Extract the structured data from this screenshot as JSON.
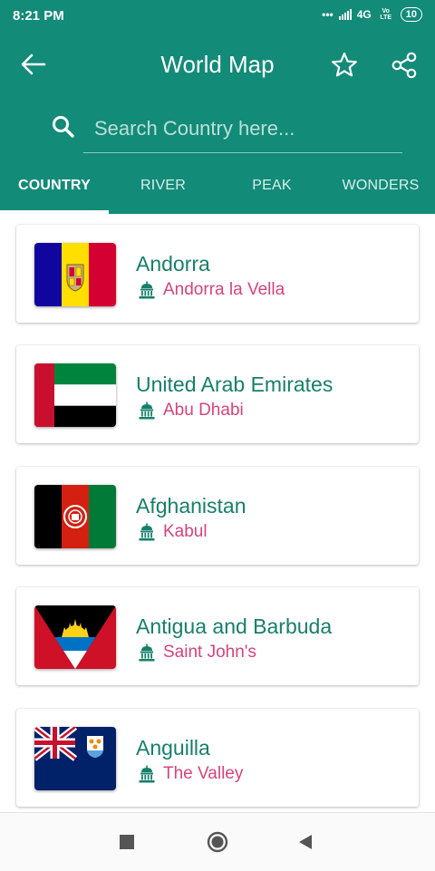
{
  "status_bar": {
    "time": "8:21 PM",
    "dots": "•••",
    "network": "4G",
    "volte": "Vo LTE",
    "battery": "10"
  },
  "toolbar": {
    "title": "World Map"
  },
  "search": {
    "placeholder": "Search Country here..."
  },
  "tabs": [
    {
      "label": "COUNTRY",
      "active": true
    },
    {
      "label": "RIVER",
      "active": false
    },
    {
      "label": "PEAK",
      "active": false
    },
    {
      "label": "WONDERS",
      "active": false
    }
  ],
  "countries": [
    {
      "name": "Andorra",
      "capital": "Andorra la Vella",
      "flag": "andorra-flag"
    },
    {
      "name": "United Arab Emirates",
      "capital": "Abu Dhabi",
      "flag": "uae-flag"
    },
    {
      "name": "Afghanistan",
      "capital": "Kabul",
      "flag": "afghanistan-flag"
    },
    {
      "name": "Antigua and Barbuda",
      "capital": "Saint John's",
      "flag": "antigua-flag"
    },
    {
      "name": "Anguilla",
      "capital": "The Valley",
      "flag": "anguilla-flag"
    }
  ],
  "colors": {
    "primary": "#128b78",
    "country_name": "#167f6b",
    "capital": "#d6437b"
  },
  "icons": {
    "back": "back-arrow-icon",
    "favorite": "star-icon",
    "share": "share-icon",
    "search": "search-icon",
    "capital": "capitol-building-icon"
  }
}
